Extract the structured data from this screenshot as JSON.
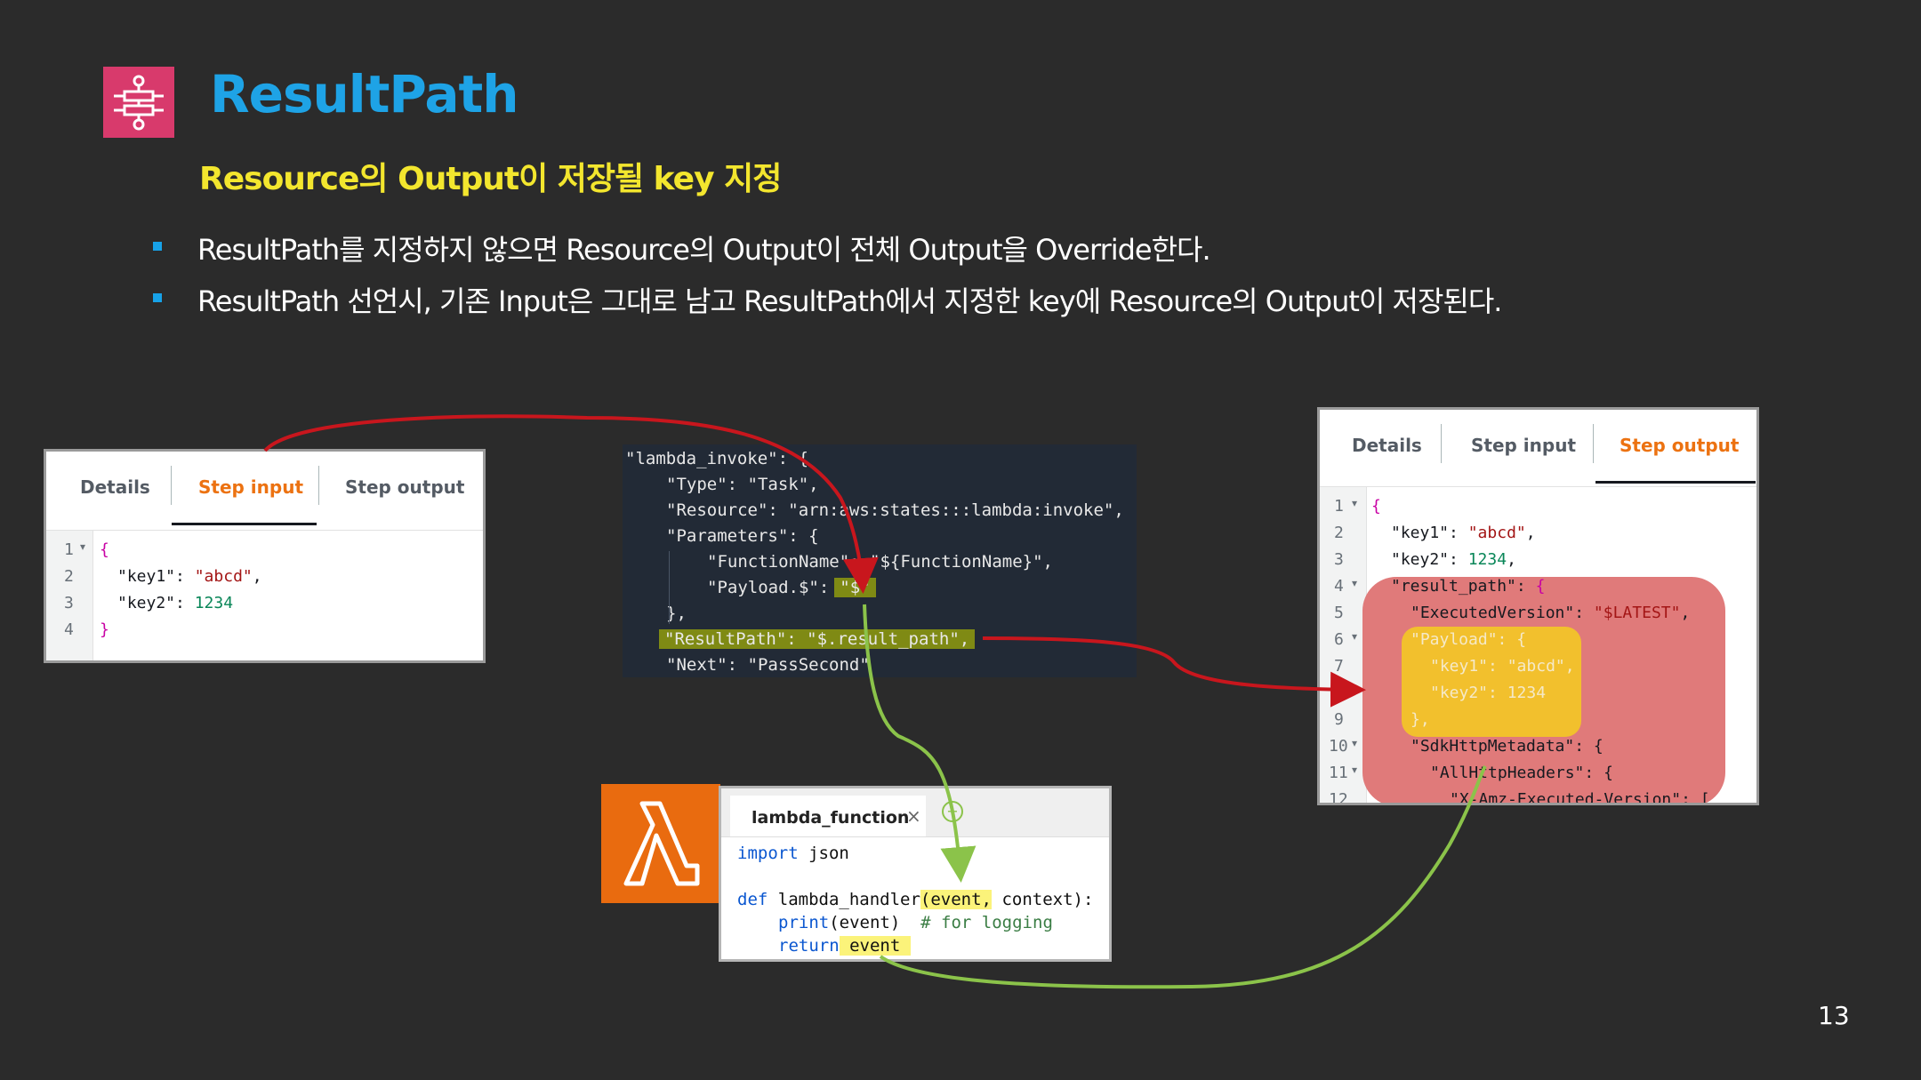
{
  "slide": {
    "title": "ResultPath",
    "subtitle": "Resource의 Output이 저장될 key 지정",
    "bullets": [
      "ResultPath를 지정하지 않으면 Resource의 Output이 전체 Output을 Override한다.",
      "ResultPath 선언시, 기존 Input은 그대로 남고 ResultPath에서 지정한 key에 Resource의 Output이 저장된다."
    ],
    "page_number": "13",
    "logo_icon": "step-functions-icon"
  },
  "input_panel": {
    "tabs": [
      "Details",
      "Step input",
      "Step output"
    ],
    "active_tab": "Step input",
    "line_numbers": [
      "1",
      "2",
      "3",
      "4"
    ],
    "code": {
      "open": "{",
      "key1_name": "\"key1\"",
      "key1_value": "\"abcd\"",
      "key2_name": "\"key2\"",
      "key2_value": "1234",
      "close": "}"
    }
  },
  "state_json": {
    "l1_key": "\"lambda_invoke\"",
    "l1_rest": ": {",
    "l2_key": "\"Type\"",
    "l2_val": "\"Task\",",
    "l3_key": "\"Resource\"",
    "l3_val": "\"arn:aws:states:::lambda:invoke\",",
    "l4_key": "\"Parameters\"",
    "l4_rest": ": {",
    "l5_key": "\"FunctionName\"",
    "l5_val": "\"${FunctionName}\",",
    "l6_key": "\"Payload.$\"",
    "l6_val": "\"$\"",
    "l7": "},",
    "l8_key": "\"ResultPath\"",
    "l8_val": "\"$.result_path\",",
    "l9_key": "\"Next\"",
    "l9_val": "\"PassSecond\""
  },
  "lambda_editor": {
    "tab_label": "lambda_function",
    "close_glyph": "×",
    "add_glyph": "+",
    "line1_kw": "import",
    "line1_rest": " json",
    "line3_kw": "def",
    "line3_name": " lambda_handler",
    "line3_params": "(event,",
    "line3_rest": " context):",
    "line4_fn": "print",
    "line4_args": "(event)",
    "line4_comment": "# for logging",
    "line5_kw": "return",
    "line5_val": " event "
  },
  "output_panel": {
    "tabs": [
      "Details",
      "Step input",
      "Step output"
    ],
    "active_tab": "Step output",
    "line_numbers": [
      "1",
      "2",
      "3",
      "4",
      "5",
      "6",
      "7",
      "8",
      "9",
      "10",
      "11",
      "12"
    ],
    "fold_markers": [
      "1",
      "4",
      "6",
      "10",
      "11"
    ],
    "code": {
      "open": "{",
      "key1_name": "\"key1\"",
      "key1_value": "\"abcd\"",
      "key2_name": "\"key2\"",
      "key2_value": "1234",
      "rp_name": "\"result_path\"",
      "ev_name": "\"ExecutedVersion\"",
      "ev_value": "\"$LATEST\"",
      "payload_name": "\"Payload\"",
      "p_key1_name": "\"key1\"",
      "p_key1_value": "\"abcd\"",
      "p_key2_name": "\"key2\"",
      "p_key2_value": "1234",
      "payload_close": "},",
      "sdk_name": "\"SdkHttpMetadata\"",
      "headers_name": "\"AllHttpHeaders\"",
      "xamz_name": "\"X-Amz-Executed-Version\""
    }
  },
  "colors": {
    "background": "#2b2b2b",
    "title": "#1ea3e6",
    "subtitle": "#f3e62e",
    "bullet": "#17a2e8",
    "active_tab": "#ec7211",
    "arrow_red": "#c8161d",
    "arrow_green": "#8bc34a",
    "lambda_orange": "#e96b0f",
    "highlight_red": "#e07a7a",
    "highlight_yellow": "#f2c02d"
  }
}
